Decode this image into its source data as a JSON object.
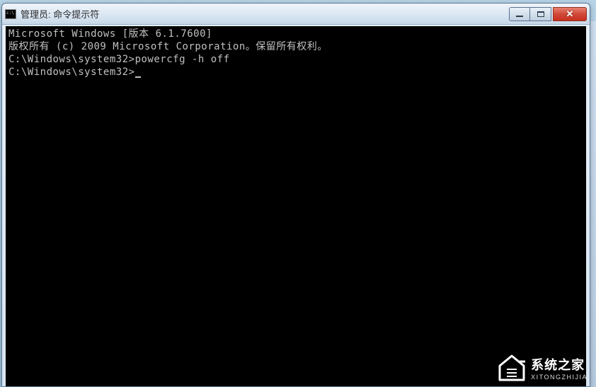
{
  "window": {
    "title": "管理员: 命令提示符"
  },
  "terminal": {
    "line1": "Microsoft Windows [版本 6.1.7600]",
    "line2": "版权所有 (c) 2009 Microsoft Corporation。保留所有权利。",
    "blank1": "",
    "prompt1_path": "C:\\Windows\\system32>",
    "prompt1_cmd": "powercfg -h off",
    "blank2": "",
    "prompt2_path": "C:\\Windows\\system32>"
  },
  "watermark": {
    "main": "系统之家",
    "sub": "XITONGZHIJIA"
  }
}
